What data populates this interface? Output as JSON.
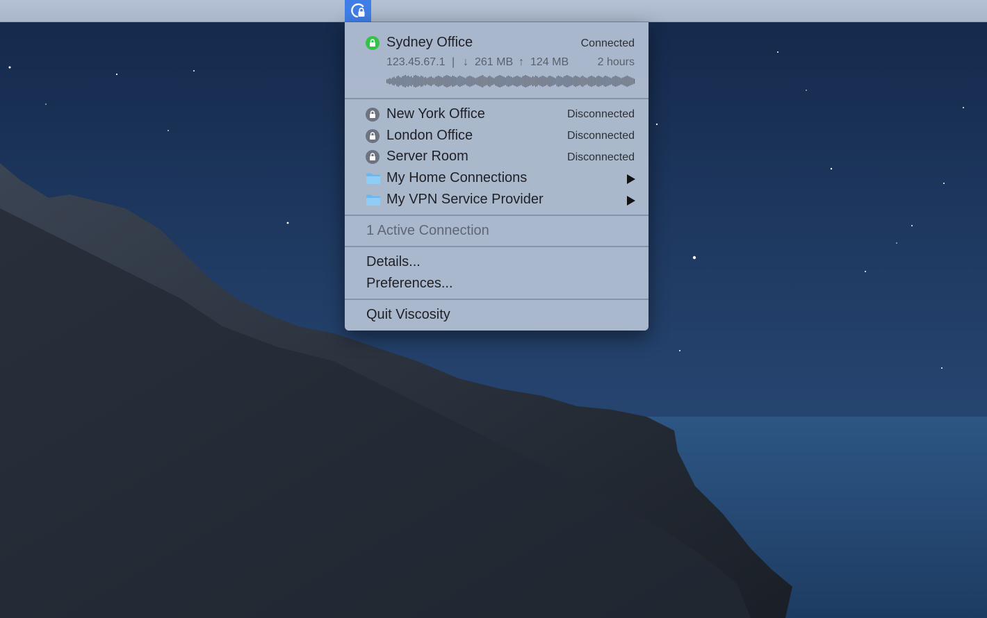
{
  "menubar": {
    "status_icon": "viscosity-lock-icon",
    "accent_color": "#3f7ee6"
  },
  "active_connection": {
    "name": "Sydney Office",
    "status": "Connected",
    "ip": "123.45.67.1",
    "separator": "|",
    "download_arrow": "↓",
    "download": "261 MB",
    "upload_arrow": "↑",
    "upload": "124 MB",
    "duration": "2 hours",
    "status_color": "#34c24a",
    "traffic_graph": [
      3,
      4,
      5,
      4,
      6,
      7,
      5,
      8,
      9,
      7,
      6,
      8,
      9,
      10,
      8,
      9,
      7,
      8,
      6,
      9,
      10,
      9,
      8,
      7,
      9,
      8,
      6,
      7,
      5,
      6,
      7,
      8,
      6,
      5,
      7,
      8,
      9,
      8,
      7,
      6,
      8,
      9,
      10,
      9,
      8,
      7,
      9,
      8,
      7,
      6,
      8,
      9,
      8,
      7,
      6,
      5,
      7,
      8,
      9,
      8,
      7,
      6,
      5,
      6,
      7,
      8,
      9,
      10,
      8,
      7,
      6,
      8,
      9,
      7,
      6,
      5,
      7,
      8,
      9,
      10,
      9,
      8,
      7,
      6,
      8,
      9,
      8,
      7,
      6,
      7,
      8,
      9,
      8,
      7,
      6,
      8,
      9,
      10,
      9,
      8,
      7,
      6,
      8,
      7,
      9,
      8,
      6,
      7,
      8,
      9,
      8,
      7,
      6,
      8,
      9,
      8,
      7,
      6,
      5,
      8,
      9,
      8,
      7,
      6,
      8,
      9,
      10,
      9,
      8,
      7,
      6,
      8,
      9,
      8,
      7,
      6,
      8,
      9,
      7,
      6,
      5,
      7,
      8,
      9,
      8,
      7,
      6,
      8,
      9,
      8,
      7,
      6,
      8,
      9,
      8,
      7,
      6,
      5,
      7,
      8,
      9,
      8,
      7,
      6,
      5,
      6,
      7,
      8,
      9,
      8,
      7,
      6,
      5,
      4
    ]
  },
  "connections": [
    {
      "name": "New York Office",
      "status": "Disconnected"
    },
    {
      "name": "London Office",
      "status": "Disconnected"
    },
    {
      "name": "Server Room",
      "status": "Disconnected"
    }
  ],
  "folders": [
    {
      "name": "My Home Connections"
    },
    {
      "name": "My VPN Service Provider"
    }
  ],
  "summary": "1 Active Connection",
  "actions": {
    "details": "Details...",
    "preferences": "Preferences...",
    "quit": "Quit Viscosity"
  },
  "icons": {
    "connected": "lock-green-icon",
    "disconnected": "lock-gray-icon",
    "folder": "folder-icon",
    "submenu": "submenu-arrow-icon"
  }
}
